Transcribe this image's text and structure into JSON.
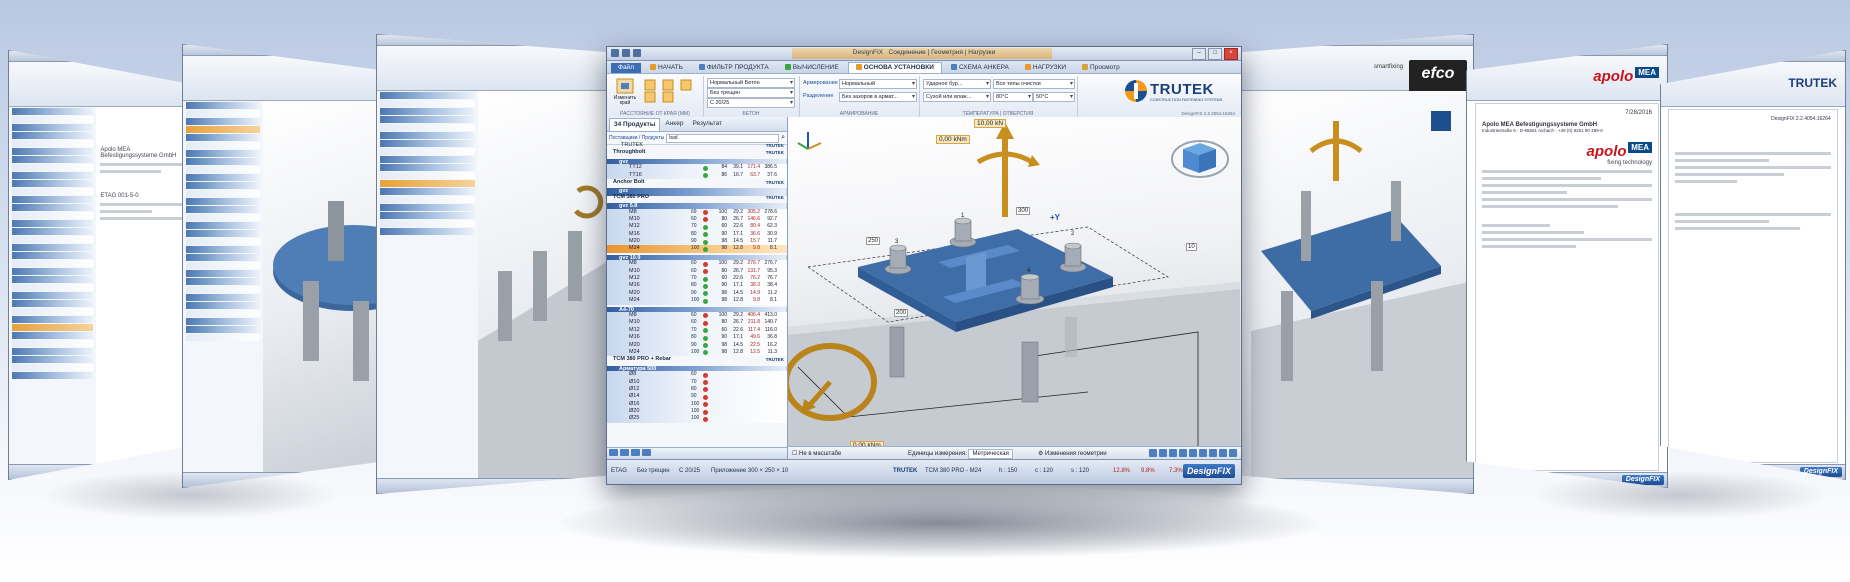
{
  "main_window": {
    "title": "DesignFIX",
    "context_tabs": "Соединение | Геометрия | Нагрузки",
    "tabs": [
      {
        "label": "Файл"
      },
      {
        "label": "НАЧАТЬ"
      },
      {
        "label": "ФИЛЬТР ПРОДУКТА"
      },
      {
        "label": "ВЫЧИСЛЕНИЕ"
      },
      {
        "label": "ОСНОВА УСТАНОВКИ"
      },
      {
        "label": "СХЕМА АНКЕРА"
      },
      {
        "label": "НАГРУЗКИ"
      },
      {
        "label": "Просмотр"
      }
    ],
    "ribbon": {
      "edge_button": "Изменить край",
      "edge_group": "РАССТОЯНИЕ ОТ КРАЯ (мм)",
      "concrete_type": "Нормальный Бетон",
      "crack_state": "Без трещин",
      "concrete_class": "C 20/25",
      "concrete_group": "БЕТОН",
      "reinforcement_label": "Армирование",
      "reinforcement_value": "Нормальный",
      "separation_label": "Разделение",
      "separation_value": "Без зазоров в армат...",
      "reinforcement_group": "АРМИРОВАНИЕ",
      "drilling": "Ударное бур...",
      "cleaning": "Все типы очистки",
      "hole_condition": "Сухой или влаж...",
      "temp_long": "80°C",
      "temp_short": "50°C",
      "temp_group": "ТЕМПЕРАТУРА | ОТВЕРСТИЯ"
    },
    "logo": {
      "brand": "TRUTEK",
      "tagline": "CONSTRUCTION FASTENING SYSTEMS",
      "version": "DesignFIX 2.2.4054.16264"
    },
    "left_panel": {
      "tabs": [
        {
          "label": "34 Продукты"
        },
        {
          "label": "Анкер"
        },
        {
          "label": "Результат"
        }
      ],
      "search_label": "Поставщики / Продукты",
      "search_value": "bad",
      "tree": [
        {
          "kind": "sub",
          "text": "TRUTEK",
          "brand": "TRUTEK"
        },
        {
          "kind": "prod",
          "text": "Throughbolt",
          "brand": "TRUTEK"
        },
        {
          "kind": "grp",
          "text": "gvz"
        },
        {
          "kind": "item",
          "text": "TT12",
          "dot": "g",
          "pct": "84",
          "v1": "39.1",
          "v2": "171.4",
          "v3": "386.5"
        },
        {
          "kind": "item",
          "text": "TT16",
          "dot": "g",
          "pct": "86",
          "v1": "16.7",
          "v2": "63.7",
          "v3": "37.6"
        },
        {
          "kind": "prod",
          "text": "Anchor Bolt",
          "brand": "TRUTEK"
        },
        {
          "kind": "grp",
          "text": "gvz"
        },
        {
          "kind": "prod",
          "text": "TCM 380 PRO",
          "brand": "TRUTEK"
        },
        {
          "kind": "grp",
          "text": "gvz 5.8"
        },
        {
          "kind": "item",
          "text": "M8",
          "m": "69",
          "dot": "r",
          "pct": "100",
          "v1": "29.2",
          "v2": "305.2",
          "v3": "278.6"
        },
        {
          "kind": "item",
          "text": "M10",
          "m": "60",
          "dot": "r",
          "pct": "80",
          "v1": "26.7",
          "v2": "146.6",
          "v3": "92.7"
        },
        {
          "kind": "item",
          "text": "M12",
          "m": "70",
          "dot": "g",
          "pct": "60",
          "v1": "22.6",
          "v2": "80.4",
          "v3": "62.3"
        },
        {
          "kind": "item",
          "text": "M16",
          "m": "80",
          "dot": "g",
          "pct": "90",
          "v1": "17.1",
          "v2": "36.6",
          "v3": "30.9"
        },
        {
          "kind": "item",
          "text": "M20",
          "m": "90",
          "dot": "g",
          "pct": "98",
          "v1": "14.5",
          "v2": "15.7",
          "v3": "11.7"
        },
        {
          "kind": "item",
          "text": "M24",
          "m": "100",
          "dot": "g",
          "pct": "98",
          "v1": "12.8",
          "v2": "9.8",
          "v3": "8.1",
          "selected": true
        },
        {
          "kind": "grp",
          "text": "gvz 10.9"
        },
        {
          "kind": "item",
          "text": "M8",
          "m": "60",
          "dot": "r",
          "pct": "100",
          "v1": "29.2",
          "v2": "276.7",
          "v3": "276.7"
        },
        {
          "kind": "item",
          "text": "M10",
          "m": "60",
          "dot": "r",
          "pct": "80",
          "v1": "26.7",
          "v2": "131.7",
          "v3": "95.3"
        },
        {
          "kind": "item",
          "text": "M12",
          "m": "70",
          "dot": "g",
          "pct": "60",
          "v1": "22.6",
          "v2": "76.2",
          "v3": "76.7"
        },
        {
          "kind": "item",
          "text": "M16",
          "m": "80",
          "dot": "g",
          "pct": "90",
          "v1": "17.1",
          "v2": "38.3",
          "v3": "38.4"
        },
        {
          "kind": "item",
          "text": "M20",
          "m": "90",
          "dot": "g",
          "pct": "98",
          "v1": "14.5",
          "v2": "14.9",
          "v3": "11.2"
        },
        {
          "kind": "item",
          "text": "M24",
          "m": "100",
          "dot": "g",
          "pct": "98",
          "v1": "12.8",
          "v2": "9.8",
          "v3": "8.1"
        },
        {
          "kind": "grp",
          "text": "A4-70"
        },
        {
          "kind": "item",
          "text": "M8",
          "m": "60",
          "dot": "r",
          "pct": "100",
          "v1": "29.2",
          "v2": "406.4",
          "v3": "413.0"
        },
        {
          "kind": "item",
          "text": "M10",
          "m": "60",
          "dot": "r",
          "pct": "80",
          "v1": "26.7",
          "v2": "211.8",
          "v3": "140.7"
        },
        {
          "kind": "item",
          "text": "M12",
          "m": "70",
          "dot": "g",
          "pct": "60",
          "v1": "22.6",
          "v2": "117.4",
          "v3": "116.0"
        },
        {
          "kind": "item",
          "text": "M16",
          "m": "80",
          "dot": "g",
          "pct": "90",
          "v1": "17.1",
          "v2": "49.6",
          "v3": "36.8"
        },
        {
          "kind": "item",
          "text": "M20",
          "m": "90",
          "dot": "g",
          "pct": "98",
          "v1": "14.5",
          "v2": "22.5",
          "v3": "16.2"
        },
        {
          "kind": "item",
          "text": "M24",
          "m": "100",
          "dot": "g",
          "pct": "98",
          "v1": "12.8",
          "v2": "12.5",
          "v3": "11.3"
        },
        {
          "kind": "prod",
          "text": "TCM 380 PRO + Rebar",
          "brand": "TRUTEK"
        },
        {
          "kind": "grp",
          "text": "Арматура 500"
        },
        {
          "kind": "item",
          "text": "Ø8",
          "m": "60",
          "dot": "r"
        },
        {
          "kind": "item",
          "text": "Ø10",
          "m": "70",
          "dot": "r"
        },
        {
          "kind": "item",
          "text": "Ø12",
          "m": "80",
          "dot": "r"
        },
        {
          "kind": "item",
          "text": "Ø14",
          "m": "90",
          "dot": "r"
        },
        {
          "kind": "item",
          "text": "Ø16",
          "m": "100",
          "dot": "r"
        },
        {
          "kind": "item",
          "text": "Ø20",
          "m": "100",
          "dot": "r"
        },
        {
          "kind": "item",
          "text": "Ø25",
          "m": "100",
          "dot": "r"
        }
      ]
    },
    "view": {
      "force_z": "10,00 kN",
      "moment_top": "0,00 kNm",
      "moment_bottom": "0,00 kNm",
      "dim_250": "250",
      "dim_300": "300",
      "dim_200": "200",
      "dim_10": "10",
      "axis_y": "+Y",
      "fasteners": [
        "1",
        "2",
        "3",
        "4"
      ],
      "checkbox": "Не в масштабе",
      "units_label": "Единицы измерения:",
      "units_value": "Метрическая",
      "geometry_label": "Изменения геометрии"
    },
    "status": {
      "norm": "ETAG",
      "crack": "Без трещин",
      "concrete": "C 20/25",
      "plate": "Приложение 300 × 250 × 10",
      "brand": "TRUTEK",
      "product": "TCM 380 PRO - M24",
      "h": "h : 150",
      "c1": "c : 120",
      "s": "s : 120",
      "p1": "12.8%",
      "p2": "9.8%",
      "p3": "7.3%",
      "logo": "DesignFIX"
    }
  },
  "side_windows": {
    "right_brand_1": "smartfixing",
    "efco": "efco",
    "apolo": "apolo",
    "mea": "MEA",
    "apolo_tagline": "fixing technology",
    "company": "Apolo MEA Befestigungssysteme GmbH",
    "address": "Industriestraße 6 - D-86551 Aichach - +49 (0) 8251 90 485-0",
    "date": "7/28/2016",
    "version_doc": "DesignFIX 2.2.4054.16264",
    "right_logo": "TRUTEK",
    "design_fix": "DesignFIX",
    "left_company": "Apolo MEA Befestigungssysteme GmbH",
    "left_etag": "ETAG 001-5-0"
  }
}
